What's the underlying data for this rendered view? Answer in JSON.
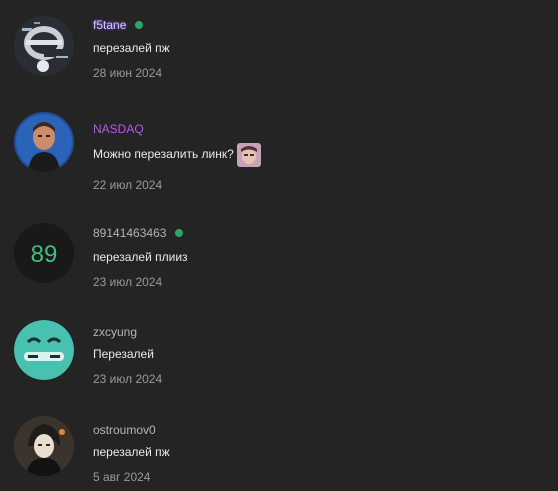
{
  "conversations": [
    {
      "nickname": "f5tane",
      "nickname_color": "#d4c7ff",
      "online": true,
      "message": "перезалей пж",
      "date": "28 июн 2024",
      "avatar_icon": "glitch-logo-icon"
    },
    {
      "nickname": "NASDAQ",
      "nickname_color": "#b15ce6",
      "online": false,
      "message": "Можно перезалить линк?",
      "date": "22 июл 2024",
      "avatar_icon": "portrait-photo-icon",
      "attachment_icon": "image-thumbnail-icon"
    },
    {
      "nickname": "89141463463",
      "nickname_color": "#b4b4b4",
      "online": true,
      "message": "перезалей плииз",
      "date": "23 июл 2024",
      "avatar_text": "89",
      "avatar_text_color": "#3fbf7f"
    },
    {
      "nickname": "zxcyung",
      "nickname_color": "#b4b4b4",
      "online": false,
      "message": "Перезалей",
      "date": "23 июл 2024",
      "avatar_icon": "cartoon-face-icon"
    },
    {
      "nickname": "ostroumov0",
      "nickname_color": "#b4b4b4",
      "online": false,
      "message": "перезалей пж",
      "date": "5 авг 2024",
      "avatar_icon": "anime-character-icon"
    }
  ],
  "colors": {
    "background": "#242424",
    "online_dot": "#2ea66a"
  }
}
